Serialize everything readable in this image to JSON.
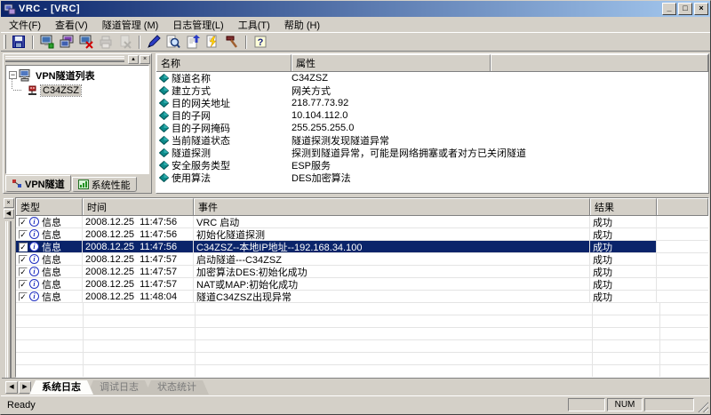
{
  "window": {
    "title": "VRC - [VRC]",
    "status_left": "Ready",
    "status_num": "NUM"
  },
  "colors": {
    "titlebar_left": "#0a246a",
    "titlebar_right": "#a6caf0",
    "selection": "#0a246a",
    "chrome": "#d4d0c8"
  },
  "menu": {
    "items": [
      {
        "label": "文件(F)"
      },
      {
        "label": "查看(V)"
      },
      {
        "label": "隧道管理 (M)"
      },
      {
        "label": "日志管理(L)"
      },
      {
        "label": "工具(T)"
      },
      {
        "label": "帮助 (H)"
      }
    ]
  },
  "toolbar": {
    "buttons": [
      {
        "icon": "save-icon"
      },
      {
        "icon": "new-tunnel-icon",
        "gap": true
      },
      {
        "icon": "tunnel-manage-icon"
      },
      {
        "icon": "delete-tunnel-icon"
      },
      {
        "icon": "print-icon",
        "disabled": true
      },
      {
        "icon": "clear-log-icon",
        "disabled": true
      },
      {
        "icon": "connect-pen-icon",
        "gap": true
      },
      {
        "icon": "search-icon"
      },
      {
        "icon": "export-log-icon"
      },
      {
        "icon": "log-config-icon"
      },
      {
        "icon": "tools-hammer-icon"
      },
      {
        "icon": "help-icon",
        "gap": true
      }
    ]
  },
  "tree": {
    "root_label": "VPN隧道列表",
    "items": [
      {
        "label": "C34ZSZ",
        "selected": true
      }
    ]
  },
  "left_tabs": [
    {
      "label": "VPN隧道",
      "active": true,
      "icon": "vpn-tab-icon"
    },
    {
      "label": "系统性能",
      "icon": "perf-tab-icon"
    }
  ],
  "properties": {
    "col_name": "名称",
    "col_value": "属性",
    "rows": [
      {
        "name": "隧道名称",
        "value": "C34ZSZ"
      },
      {
        "name": "建立方式",
        "value": "网关方式"
      },
      {
        "name": "目的网关地址",
        "value": "218.77.73.92"
      },
      {
        "name": "目的子网",
        "value": "10.104.112.0"
      },
      {
        "name": "目的子网掩码",
        "value": "255.255.255.0"
      },
      {
        "name": "当前隧道状态",
        "value": "隧道探测发现隧道异常"
      },
      {
        "name": "隧道探测",
        "value": "探测到隧道异常，可能是网络拥塞或者对方已关闭隧道"
      },
      {
        "name": "安全服务类型",
        "value": "ESP服务"
      },
      {
        "name": "使用算法",
        "value": "DES加密算法"
      }
    ]
  },
  "log": {
    "col_type": "类型",
    "col_time": "时间",
    "col_event": "事件",
    "col_result": "结果",
    "rows": [
      {
        "type": "信息",
        "time": "2008.12.25  11:47:56",
        "event": "VRC 启动",
        "result": "成功"
      },
      {
        "type": "信息",
        "time": "2008.12.25  11:47:56",
        "event": "初始化隧道探测",
        "result": "成功"
      },
      {
        "type": "信息",
        "time": "2008.12.25  11:47:56",
        "event": "C34ZSZ--本地IP地址--192.168.34.100",
        "result": "成功",
        "selected": true
      },
      {
        "type": "信息",
        "time": "2008.12.25  11:47:57",
        "event": "启动隧道---C34ZSZ",
        "result": "成功"
      },
      {
        "type": "信息",
        "time": "2008.12.25  11:47:57",
        "event": "加密算法DES:初始化成功",
        "result": "成功"
      },
      {
        "type": "信息",
        "time": "2008.12.25  11:47:57",
        "event": "NAT或MAP:初始化成功",
        "result": "成功"
      },
      {
        "type": "信息",
        "time": "2008.12.25  11:48:04",
        "event": "隧道C34ZSZ出现异常",
        "result": "成功"
      }
    ]
  },
  "bottom_tabs": [
    {
      "label": "系统日志",
      "active": true
    },
    {
      "label": "调试日志",
      "disabled": true
    },
    {
      "label": "状态统计",
      "disabled": true
    }
  ],
  "glyphs": {
    "minimize": "_",
    "maximize": "□",
    "close": "×",
    "panel_min": "▴",
    "panel_close": "×",
    "strip_close": "×",
    "strip_collapse": "◀",
    "tab_prev": "◀",
    "tab_next": "▶",
    "check": "✓",
    "info": "i",
    "expand_minus": "−"
  }
}
